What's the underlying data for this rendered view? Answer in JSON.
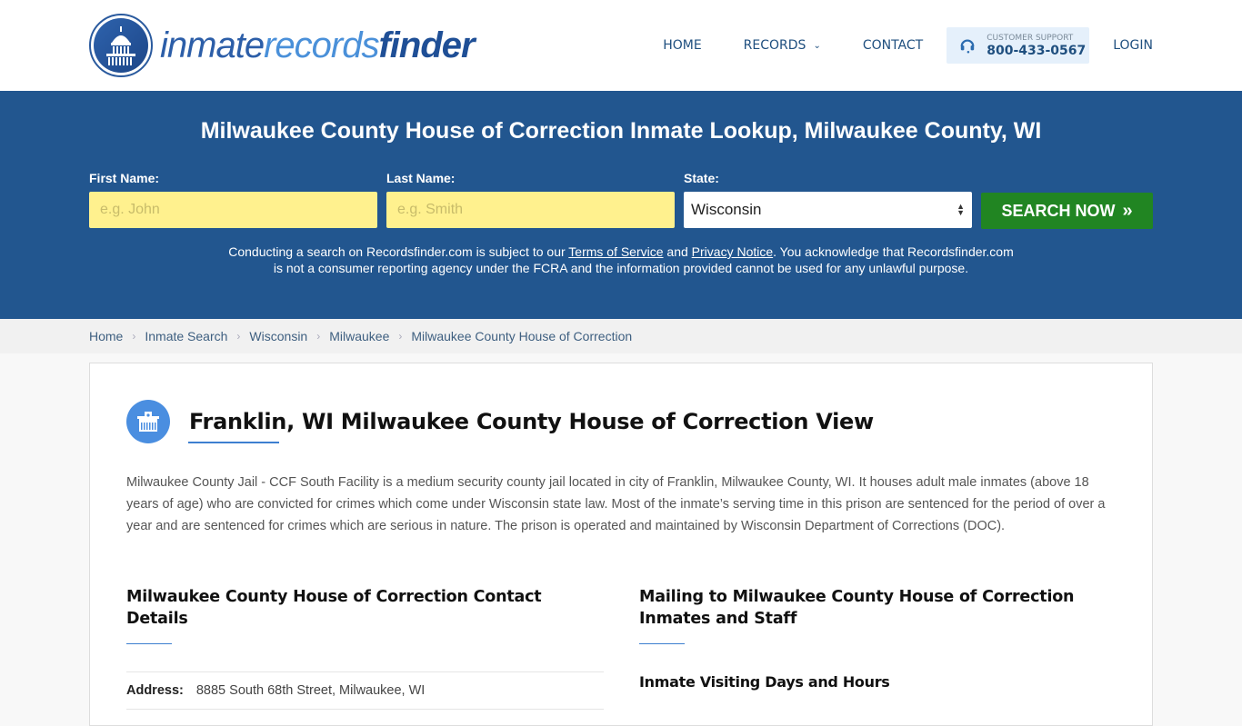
{
  "header": {
    "logo": {
      "part1": "inmate",
      "part2": "records",
      "part3": "finder"
    },
    "nav": {
      "home": "HOME",
      "records": "RECORDS",
      "contact": "CONTACT",
      "support_label": "CUSTOMER SUPPORT",
      "support_phone": "800-433-0567",
      "login": "LOGIN"
    }
  },
  "search": {
    "title": "Milwaukee County House of Correction Inmate Lookup, Milwaukee County, WI",
    "first_name_label": "First Name:",
    "first_name_placeholder": "e.g. John",
    "last_name_label": "Last Name:",
    "last_name_placeholder": "e.g. Smith",
    "state_label": "State:",
    "state_value": "Wisconsin",
    "button_label": "SEARCH NOW",
    "disclaimer": {
      "part1": "Conducting a search on Recordsfinder.com is subject to our ",
      "terms": "Terms of Service",
      "and": " and ",
      "privacy": "Privacy Notice",
      "part2": ". You acknowledge that Recordsfinder.com is not a consumer reporting agency under the FCRA and the information provided cannot be used for any unlawful purpose."
    }
  },
  "breadcrumb": [
    "Home",
    "Inmate Search",
    "Wisconsin",
    "Milwaukee",
    "Milwaukee County House of Correction"
  ],
  "main": {
    "title": "Franklin, WI Milwaukee County House of Correction View",
    "intro": "Milwaukee County Jail - CCF South Facility is a medium security county jail located in city of Franklin, Milwaukee County, WI. It houses adult male inmates (above 18 years of age) who are convicted for crimes which come under Wisconsin state law. Most of the inmate’s serving time in this prison are sentenced for the period of over a year and are sentenced for crimes which are serious in nature. The prison is operated and maintained by Wisconsin Department of Corrections (DOC).",
    "contact": {
      "heading": "Milwaukee County House of Correction Contact Details",
      "address_label": "Address:",
      "address_value": "8885 South 68th Street, Milwaukee, WI"
    },
    "mailing": {
      "heading": "Mailing to Milwaukee County House of Correction Inmates and Staff",
      "visiting_heading": "Inmate Visiting Days and Hours"
    }
  },
  "colors": {
    "brand_blue": "#22568f",
    "accent_blue": "#3d7fd0",
    "search_green": "#218522",
    "input_yellow": "#fff18e"
  }
}
